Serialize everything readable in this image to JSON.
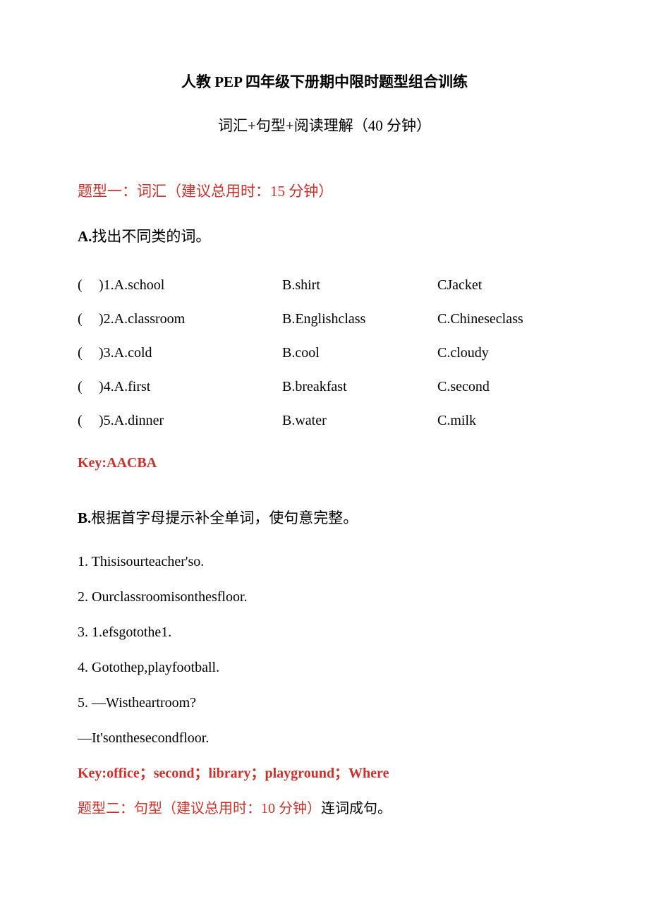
{
  "title_main": "人教 PEP 四年级下册期中限时题型组合训练",
  "title_sub": "词汇+句型+阅读理解（40 分钟）",
  "section1_heading": "题型一：词汇（建议总用时：15 分钟）",
  "sectionA_heading": "A.找出不同类的词。",
  "paren_open": "(",
  "mcq": [
    {
      "label": ")1.A.school",
      "b": "B.shirt",
      "c": "CJacket"
    },
    {
      "label": ")2.A.classroom",
      "b": "B.Englishclass",
      "c": "C.Chineseclass"
    },
    {
      "label": ")3.A.cold",
      "b": "B.cool",
      "c": "C.cloudy"
    },
    {
      "label": ")4.A.first",
      "b": "B.breakfast",
      "c": "C.second"
    },
    {
      "label": ")5.A.dinner",
      "b": "B.water",
      "c": "C.milk"
    }
  ],
  "keyA": "Key:AACBA",
  "sectionB_heading": "B.根据首字母提示补全单词，使句意完整。",
  "fill_items": [
    "1.  Thisisourteacher'so.",
    "2.  Ourclassroomisonthesfloor.",
    "3.  1.efsgotothe1.",
    "4.  Gotothep,playfootball.",
    "5.  —Wistheartroom?"
  ],
  "fill_extra": "—It'sonthesecondfloor.",
  "keyB": "Key:office；second；library；playground；Where",
  "section2_red": "题型二：句型（建议总用时：10 分钟）",
  "section2_black": "连词成句。"
}
